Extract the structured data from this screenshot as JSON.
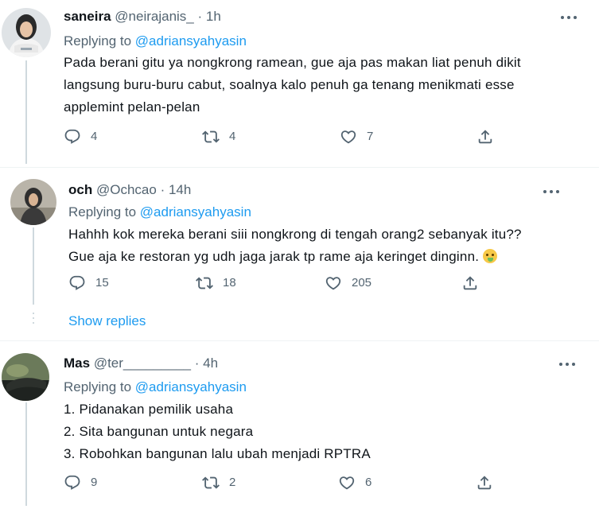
{
  "tweets": [
    {
      "name": "saneira",
      "handle": "@neirajanis_",
      "dot": "·",
      "time": "1h",
      "replying_label": "Replying to",
      "replying_to": "@adriansyahyasin",
      "lines": [
        "Pada berani gitu ya nongkrong ramean, gue aja pas makan liat penuh dikit",
        "langsung buru-buru cabut, soalnya kalo penuh ga tenang menikmati esse",
        "applemint pelan-pelan"
      ],
      "replies": "4",
      "retweets": "4",
      "likes": "7"
    },
    {
      "name": "och",
      "handle": "@Ochcao",
      "dot": "·",
      "time": "14h",
      "replying_label": "Replying to",
      "replying_to": "@adriansyahyasin",
      "lines": [
        "Hahhh kok mereka berani siii nongkrong di tengah orang2 sebanyak itu??",
        "Gue aja ke restoran yg udh jaga jarak tp rame aja keringet dinginn."
      ],
      "emoji": "drooling-face-emoji",
      "replies": "15",
      "retweets": "18",
      "likes": "205",
      "show_replies": "Show replies"
    },
    {
      "name": "Mas",
      "handle": "@ter_________",
      "dot": "·",
      "time": "4h",
      "replying_label": "Replying to",
      "replying_to": "@adriansyahyasin",
      "lines": [
        "1. Pidanakan pemilik usaha",
        "2. Sita bangunan untuk negara",
        "3. Robohkan bangunan lalu ubah menjadi RPTRA"
      ],
      "replies": "9",
      "retweets": "2",
      "likes": "6"
    }
  ],
  "colors": {
    "text": "#0f1419",
    "secondary": "#536471",
    "link": "#1d9bf0",
    "divider": "#eff3f4",
    "thread_line": "#cfd9de"
  },
  "icons": [
    "reply-icon",
    "retweet-icon",
    "like-icon",
    "share-icon",
    "more-icon"
  ]
}
